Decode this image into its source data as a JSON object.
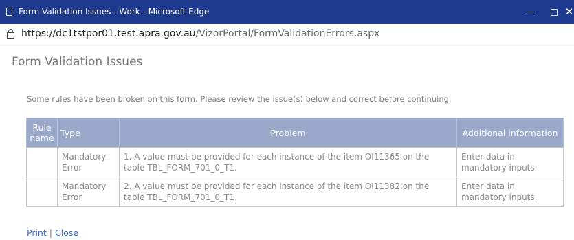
{
  "window": {
    "title": "Form Validation Issues - Work - Microsoft Edge",
    "minimize_symbol": "",
    "maximize_symbol": "",
    "close_symbol": "✕"
  },
  "address_bar": {
    "url_host": "https://dc1tstpor01.test.apra.gov.au",
    "url_path": "/VizorPortal/FormValidationErrors.aspx"
  },
  "page": {
    "title": "Form Validation Issues",
    "message": "Some rules have been broken on this form. Please review the issue(s) below and correct before continuing."
  },
  "table": {
    "headers": {
      "rule_name": "Rule name",
      "type": "Type",
      "problem": "Problem",
      "additional_info": "Additional information"
    },
    "rows": [
      {
        "rule_name": "",
        "type": "Mandatory Error",
        "problem": "1. A value must be provided for each instance of the item OI11365 on the table TBL_FORM_701_0_T1.",
        "additional_info": "Enter data in mandatory inputs."
      },
      {
        "rule_name": "",
        "type": "Mandatory Error",
        "problem": "2. A value must be provided for each instance of the item OI11382 on the table TBL_FORM_701_0_T1.",
        "additional_info": "Enter data in mandatory inputs."
      }
    ]
  },
  "links": {
    "print": "Print",
    "separator": "|",
    "close": "Close"
  },
  "colors": {
    "titlebar": "#1e3a8f",
    "table_header": "#9aa9c9",
    "link": "#3b66c4"
  }
}
